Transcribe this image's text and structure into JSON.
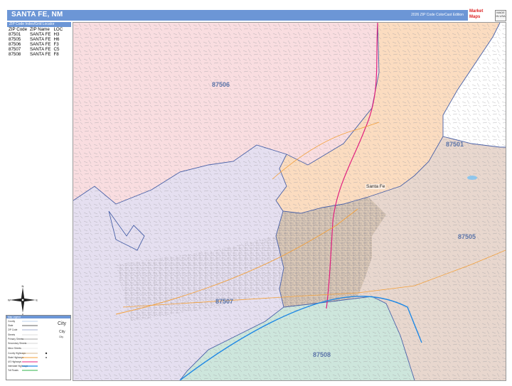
{
  "title": "SANTA FE, NM",
  "edition": "2026 ZIP Code ColorCast Edition",
  "logo_text": "Market Maps",
  "badge_text": "MADE IN USA",
  "index": {
    "heading": "ZIP Code Index/Grid Locator",
    "columns": [
      "ZIP Code",
      "ZIP Name",
      "LOC"
    ],
    "rows": [
      [
        "87501",
        "SANTA FE",
        "H3"
      ],
      [
        "87505",
        "SANTA FE",
        "H6"
      ],
      [
        "87506",
        "SANTA FE",
        "F3"
      ],
      [
        "87507",
        "SANTA FE",
        "C5"
      ],
      [
        "87508",
        "SANTA FE",
        "F8"
      ]
    ]
  },
  "zips": {
    "z87506": {
      "label": "87506",
      "color": "#f9dde0"
    },
    "z87501": {
      "label": "87501",
      "color": "#fbdcc0"
    },
    "z87507": {
      "label": "87507",
      "color": "#e5dff0"
    },
    "z87505": {
      "label": "87505",
      "color": "#e8d7ce"
    },
    "z87505b": {
      "color": "#d9c7b6"
    },
    "z87508": {
      "label": "87508",
      "color": "#cde6dc"
    }
  },
  "city": "Santa Fe",
  "colors": {
    "boundary": "#4a62a8",
    "interstate": "#1e88e5",
    "us_highway": "#e0207e",
    "state_highway": "#f3a03a",
    "street": "#9a9aa0",
    "water": "#8fc6ec"
  },
  "legend": {
    "heading": "Map Legend",
    "items": [
      "County",
      "State",
      "ZIP Code",
      "Streets",
      "Primary Streets",
      "Secondary Streets",
      "Minor Streets",
      "County Highways",
      "State Highways",
      "US Highways",
      "Interstate Highways",
      "Toll Roads"
    ],
    "city_large": "City",
    "city_medium": "City",
    "city_small": "City"
  },
  "compass": {
    "n": "N",
    "s": "S",
    "e": "E",
    "w": "W"
  }
}
